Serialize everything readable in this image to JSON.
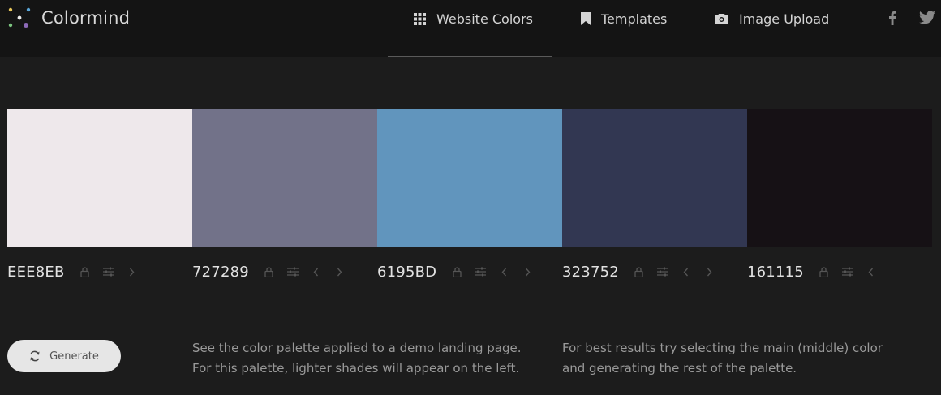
{
  "header": {
    "brand": "Colormind",
    "nav": [
      {
        "label": "Website Colors",
        "icon": "grid-icon"
      },
      {
        "label": "Templates",
        "icon": "bookmark-icon"
      },
      {
        "label": "Image Upload",
        "icon": "camera-icon"
      }
    ],
    "social": [
      {
        "icon": "facebook-icon"
      },
      {
        "icon": "twitter-icon"
      }
    ]
  },
  "palette": [
    {
      "hex": "EEE8EB",
      "color": "#EEE8EB",
      "arrows": [
        "right"
      ]
    },
    {
      "hex": "727289",
      "color": "#727289",
      "arrows": [
        "left",
        "right"
      ]
    },
    {
      "hex": "6195BD",
      "color": "#6195BD",
      "arrows": [
        "left",
        "right"
      ]
    },
    {
      "hex": "323752",
      "color": "#323752",
      "arrows": [
        "left",
        "right"
      ]
    },
    {
      "hex": "161115",
      "color": "#161115",
      "arrows": [
        "left"
      ]
    }
  ],
  "generate": {
    "label": "Generate",
    "icon": "refresh-icon"
  },
  "info": {
    "left": [
      "See the color palette applied to a demo landing page.",
      "For this palette, lighter shades will appear on the left."
    ],
    "right": [
      "For best results try selecting the main (middle) color",
      "and generating the rest of the palette."
    ]
  },
  "theme": {
    "background": "#1c1c1c",
    "header": "#141414",
    "text": "#bdbdbd"
  }
}
